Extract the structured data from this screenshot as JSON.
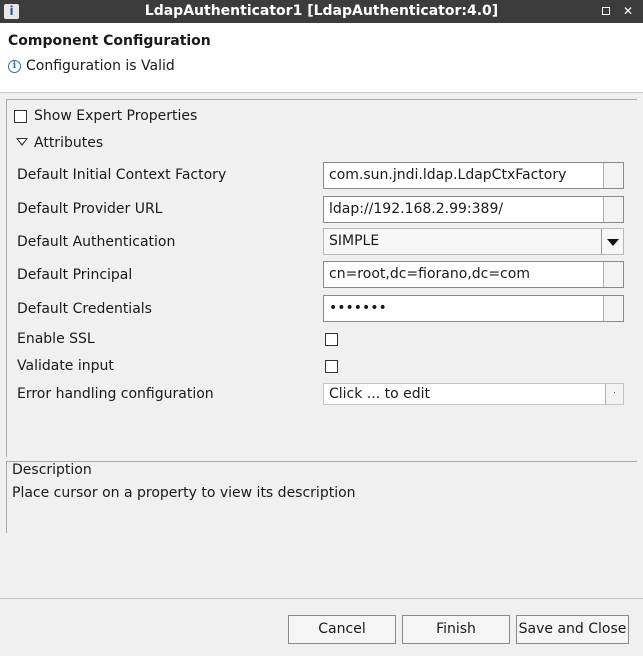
{
  "window": {
    "title": "LdapAuthenticator1 [LdapAuthenticator:4.0]",
    "minimize_glyph": "▫",
    "close_glyph": "✕"
  },
  "header": {
    "title": "Component Configuration",
    "status": "Configuration is Valid"
  },
  "options": {
    "show_expert_label": "Show Expert Properties",
    "show_expert_checked": false,
    "attributes_label": "Attributes"
  },
  "properties": [
    {
      "label": "Default Initial Context Factory",
      "value": "com.sun.jndi.ldap.LdapCtxFactory"
    },
    {
      "label": "Default Provider URL",
      "value": "ldap://192.168.2.99:389/"
    },
    {
      "label": "Default Authentication",
      "value": "SIMPLE"
    },
    {
      "label": "Default Principal",
      "value": "cn=root,dc=fiorano,dc=com"
    },
    {
      "label": "Default Credentials",
      "value": "•••••••"
    },
    {
      "label": "Enable SSL",
      "checked": false
    },
    {
      "label": "Validate input",
      "checked": false
    },
    {
      "label": "Error handling configuration",
      "value": "Click ... to edit"
    }
  ],
  "description": {
    "title": "Description",
    "text": "Place cursor on a property to view its description"
  },
  "buttons": {
    "cancel": "Cancel",
    "finish": "Finish",
    "save_close": "Save and Close"
  }
}
